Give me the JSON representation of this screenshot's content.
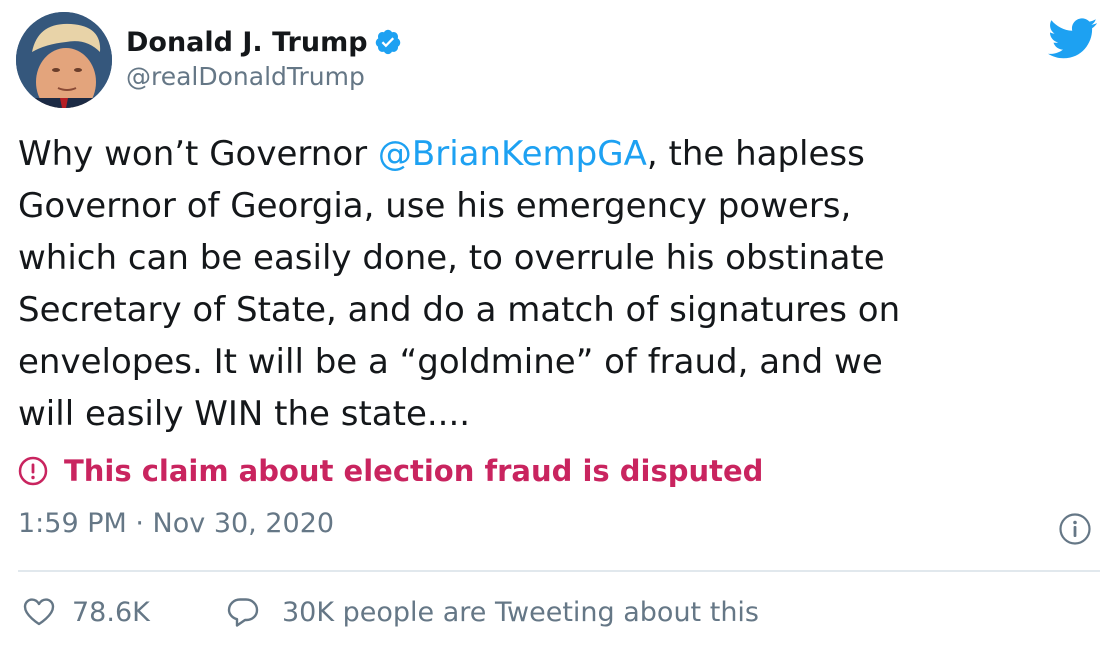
{
  "author": {
    "display_name": "Donald J. Trump",
    "handle": "@realDonaldTrump",
    "verified": true
  },
  "icons": {
    "verified": "verified-badge-icon",
    "brand": "twitter-bird-icon",
    "disputed": "exclamation-circle-icon",
    "info": "info-circle-icon",
    "like": "heart-icon",
    "reply": "speech-bubble-icon"
  },
  "tweet": {
    "lines": [
      {
        "before": "Why won’t Governor ",
        "mention": "@BrianKempGA",
        "after": ", the hapless"
      },
      {
        "text": "Governor of Georgia, use his emergency powers,"
      },
      {
        "text": "which can be easily done, to overrule his obstinate"
      },
      {
        "text": "Secretary of State, and do a match of signatures on"
      },
      {
        "text": "envelopes. It will be a “goldmine” of fraud, and we"
      },
      {
        "text": "will easily WIN the state...."
      }
    ]
  },
  "label": {
    "disputed_text": "This claim about election fraud is disputed"
  },
  "meta": {
    "timestamp": "1:59 PM · Nov 30, 2020"
  },
  "engagement": {
    "likes": "78.6K",
    "conversation": "30K people are Tweeting about this"
  },
  "colors": {
    "brand_blue": "#1da1f2",
    "disputed_red": "#c9245f",
    "secondary_gray": "#657786",
    "text": "#14171a",
    "divider": "#e1e8ed"
  }
}
